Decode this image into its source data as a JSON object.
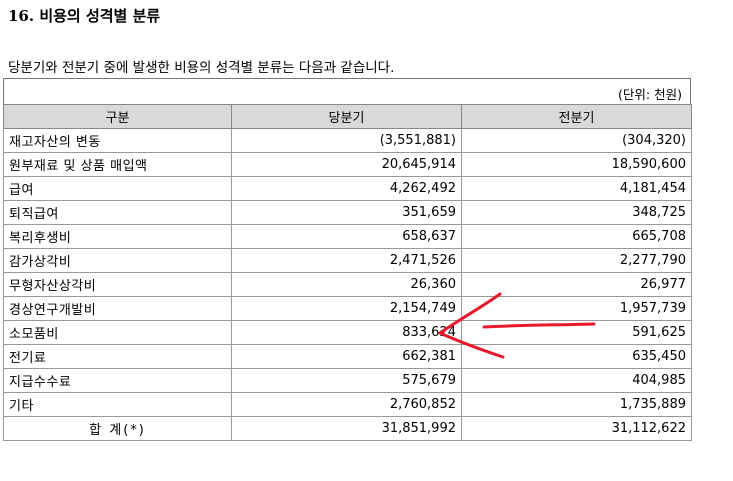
{
  "section": {
    "title": "16. 비용의 성격별 분류"
  },
  "intro": "당분기와 전분기 중에 발생한 비용의 성격별 분류는 다음과 같습니다.",
  "unit": "(단위: 천원)",
  "table": {
    "headers": [
      "구분",
      "당분기",
      "전분기"
    ],
    "rows": [
      [
        "재고자산의 변동",
        "(3,551,881)",
        "(304,320)"
      ],
      [
        "원부재료 및 상품 매입액",
        "20,645,914",
        "18,590,600"
      ],
      [
        "급여",
        "4,262,492",
        "4,181,454"
      ],
      [
        "퇴직급여",
        "351,659",
        "348,725"
      ],
      [
        "복리후생비",
        "658,637",
        "665,708"
      ],
      [
        "감가상각비",
        "2,471,526",
        "2,277,790"
      ],
      [
        "무형자산상각비",
        "26,360",
        "26,977"
      ],
      [
        "경상연구개발비",
        "2,154,749",
        "1,957,739"
      ],
      [
        "소모품비",
        "833,624",
        "591,625"
      ],
      [
        "전기료",
        "662,381",
        "635,450"
      ],
      [
        "지급수수료",
        "575,679",
        "404,985"
      ],
      [
        "기타",
        "2,760,852",
        "1,735,889"
      ]
    ],
    "total": [
      "합 계(*)",
      "31,851,992",
      "31,112,622"
    ]
  },
  "annotation": {
    "color": "#e8192c"
  }
}
